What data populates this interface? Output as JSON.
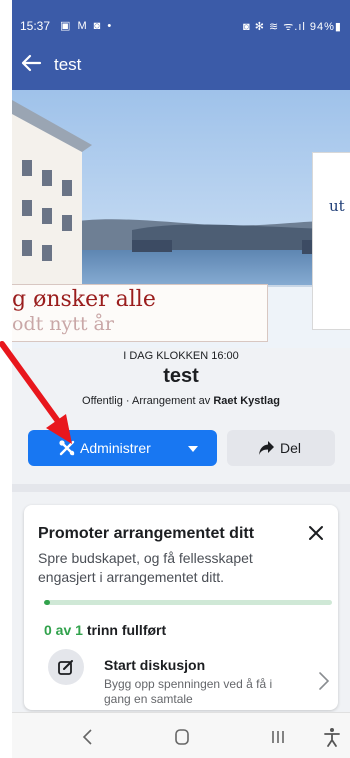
{
  "status_bar": {
    "time": "15:37",
    "left_icons": "▣ M ◙ •",
    "right_icons": "◙ ✻ ≋ ᯤ.ıl 94%▮"
  },
  "app_bar": {
    "title": "test",
    "back_icon": "arrow-left-icon"
  },
  "cover": {
    "greeting_line1": "g ønsker alle",
    "greeting_line2": "odt nytt år",
    "banner_text": "ut"
  },
  "event": {
    "date_line": "I DAG KLOKKEN 16:00",
    "title": "test",
    "sub_prefix": "Offentlig · Arrangement av ",
    "host": "Raet Kystlag"
  },
  "actions": {
    "manage_label": "Administrer",
    "share_label": "Del",
    "accent": "#1877f2"
  },
  "promote": {
    "title": "Promoter arrangementet ditt",
    "description": "Spre budskapet, og få fellesskapet engasjert i arrangementet ditt.",
    "progress_fraction": 0.02,
    "steps_done": "0 av 1",
    "steps_rest": " trinn fullført",
    "task_title": "Start diskusjon",
    "task_description": "Bygg opp spenningen ved å få i gang en samtale"
  },
  "colors": {
    "header_blue": "#3b5ba8",
    "progress_green": "#31a24c",
    "annotation_red": "#e8171d"
  },
  "nav_bar": {
    "icons": [
      "back-chevron-icon",
      "home-icon",
      "recents-icon",
      "accessibility-icon"
    ]
  }
}
